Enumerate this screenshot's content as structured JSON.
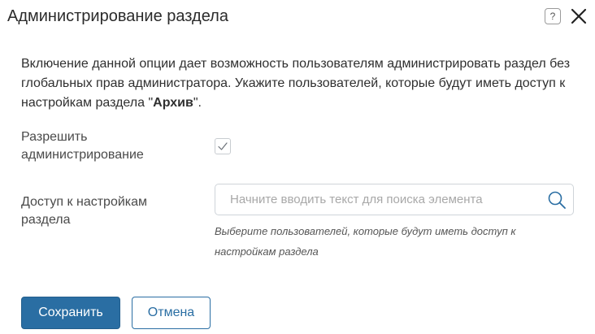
{
  "dialog": {
    "title": "Администрирование раздела",
    "help_label": "?",
    "description_text": "Включение данной опции дает возможность пользователям администрировать раздел без глобальных прав администратора. Укажите пользователей, которые будут иметь доступ к настройкам раздела \"",
    "description_section_name": "Архив",
    "description_end": "\"."
  },
  "form": {
    "allow_admin_label": "Разрешить администрирование",
    "allow_admin_checked": true,
    "access_label": "Доступ к настройкам раздела",
    "search_placeholder": "Начните вводить текст для поиска элемента",
    "search_value": "",
    "hint": "Выберите пользователей, которые будут иметь доступ к настройкам раздела"
  },
  "buttons": {
    "save": "Сохранить",
    "cancel": "Отмена"
  },
  "icons": {
    "help": "help-icon",
    "close": "close-icon",
    "check": "check-icon",
    "search": "search-icon"
  },
  "colors": {
    "primary": "#2a6ea3",
    "border": "#cfd4d9",
    "text": "#333333"
  }
}
